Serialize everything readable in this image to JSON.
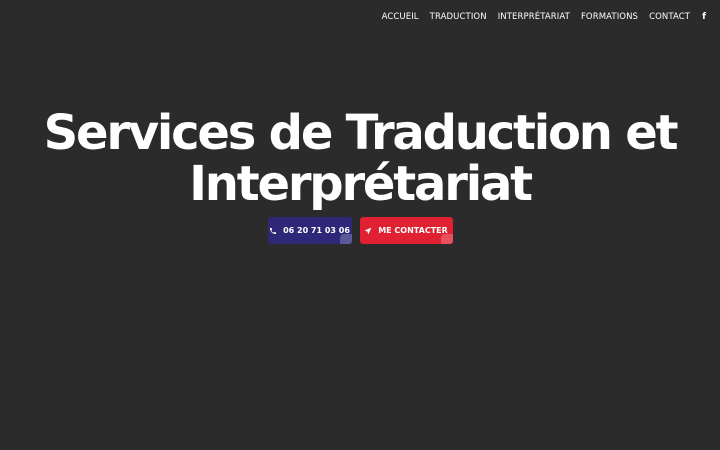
{
  "nav": {
    "items": [
      {
        "label": "ACCUEIL"
      },
      {
        "label": "TRADUCTION"
      },
      {
        "label": "INTERPRÉTARIAT"
      },
      {
        "label": "FORMATIONS"
      },
      {
        "label": "CONTACT"
      }
    ],
    "facebook_icon": "facebook-icon",
    "facebook_glyph": "f"
  },
  "hero": {
    "title_line1": "Services de Traduction et",
    "title_line2": "Interprétariat"
  },
  "cta": {
    "phone_label": "06 20 71 03 06",
    "phone_icon": "phone-icon",
    "contact_label": "ME CONTACTER",
    "contact_icon": "send-arrow-icon"
  },
  "colors": {
    "background": "#2b2b2b",
    "phone_button": "#2f2879",
    "contact_button": "#e02131",
    "text": "#ffffff"
  }
}
